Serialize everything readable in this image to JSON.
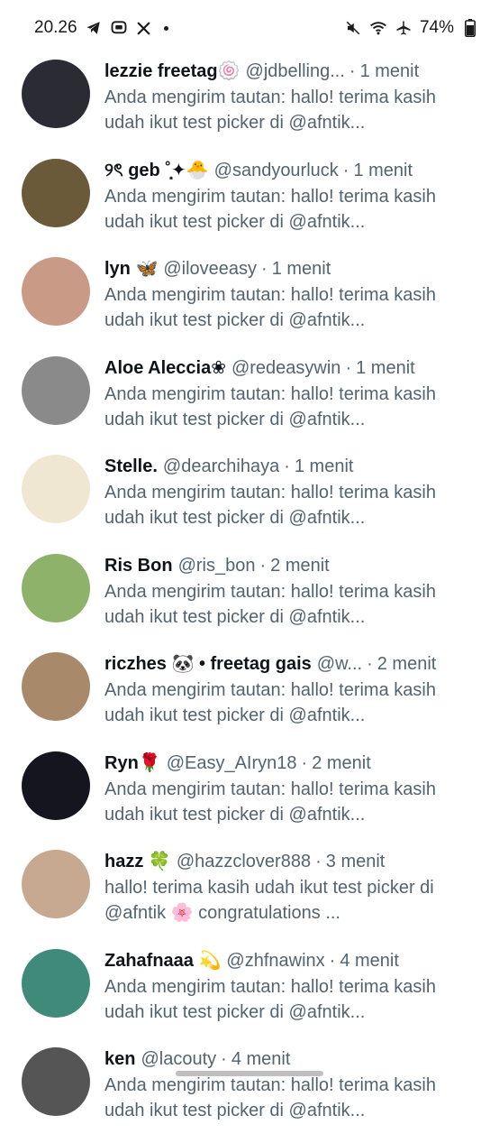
{
  "status_bar": {
    "time": "20.26",
    "left_icons": [
      "telegram-icon",
      "chat-icon",
      "x-icon"
    ],
    "right_icons": [
      "mute-icon",
      "wifi-icon",
      "airplane-icon",
      "battery-icon"
    ],
    "battery": "74%"
  },
  "colors": {
    "name": "#0f1419",
    "secondary": "#536471",
    "background": "#ffffff"
  },
  "messages": [
    {
      "name": "lezzie freetag🍥",
      "handle": "@jdbelling...",
      "time": "1 menit",
      "preview": "Anda mengirim tautan: hallo! terima kasih udah ikut test picker di @afntik...",
      "avatar_color": "#2b2b35"
    },
    {
      "name": "୨ৎ geb ˚̣̣̣͙✦🐣",
      "handle": "@sandyourluck",
      "time": "1 menit",
      "preview": "Anda mengirim tautan: hallo! terima kasih udah ikut test picker di @afntik...",
      "avatar_color": "#6b5a3a"
    },
    {
      "name": "lyn 🦋",
      "handle": "@iloveeasy",
      "time": "1 menit",
      "preview": "Anda mengirim tautan: hallo! terima kasih udah ikut test picker di @afntik...",
      "avatar_color": "#c99a86"
    },
    {
      "name": "Aloe Aleccia❀",
      "handle": "@redeasywin",
      "time": "1 menit",
      "preview": "Anda mengirim tautan: hallo! terima kasih udah ikut test picker di @afntik...",
      "avatar_color": "#8a8a8a"
    },
    {
      "name": "Stelle.",
      "handle": "@dearchihaya",
      "time": "1 menit",
      "preview": "Anda mengirim tautan: hallo! terima kasih udah ikut test picker di @afntik...",
      "avatar_color": "#efe7d2"
    },
    {
      "name": "Ris Bon",
      "handle": "@ris_bon",
      "time": "2 menit",
      "preview": "Anda mengirim tautan: hallo! terima kasih udah ikut test picker di @afntik...",
      "avatar_color": "#8fb26a"
    },
    {
      "name": "riczhes 🐼 • freetag gais",
      "handle": "@w...",
      "time": "2 menit",
      "preview": "Anda mengirim tautan: hallo! terima kasih udah ikut test picker di @afntik...",
      "avatar_color": "#a88a6a"
    },
    {
      "name": "Ryn🌹",
      "handle": "@Easy_AIryn18",
      "time": "2 menit",
      "preview": "Anda mengirim tautan: hallo! terima kasih udah ikut test picker di @afntik...",
      "avatar_color": "#151520"
    },
    {
      "name": "hazz 🍀",
      "handle": "@hazzclover888",
      "time": "3 menit",
      "preview": "hallo! terima kasih udah ikut test picker di @afntik 🌸 congratulations ...",
      "avatar_color": "#c7a890"
    },
    {
      "name": "Zahafnaaa 💫",
      "handle": "@zhfnawinx",
      "time": "4 menit",
      "preview": "Anda mengirim tautan: hallo! terima kasih udah ikut test picker di @afntik...",
      "avatar_color": "#3f8a7a"
    },
    {
      "name": "ken",
      "handle": "@lacouty",
      "time": "4 menit",
      "preview": "Anda mengirim tautan: hallo! terima kasih udah ikut test picker di @afntik...",
      "avatar_color": "#555555"
    }
  ]
}
